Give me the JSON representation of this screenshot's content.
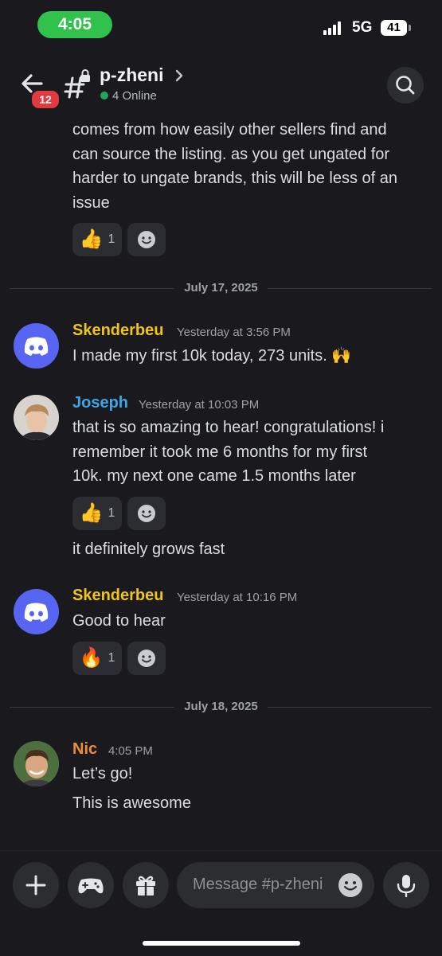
{
  "status_bar": {
    "time": "4:05",
    "network": "5G",
    "battery": "41"
  },
  "header": {
    "unread_badge": "12",
    "channel_name": "p-zheni",
    "online": "4 Online"
  },
  "messages": {
    "m0": {
      "lines": [
        "comes from how easily other sellers find and",
        "can source the listing. as you get ungated for",
        "harder to ungate brands, this will be less of an",
        "issue"
      ],
      "reaction": {
        "emoji": "👍",
        "count": "1"
      }
    },
    "divider1": "July 17, 2025",
    "m1": {
      "author": "Skenderbeu",
      "timestamp": "Yesterday at 3:56 PM",
      "text": "I made my first 10k today, 273 units. 🙌"
    },
    "m2": {
      "author": "Joseph",
      "timestamp": "Yesterday at 10:03 PM",
      "lines": [
        "that is so amazing to hear! congratulations! i",
        "remember it took me 6 months for my first",
        "10k. my next one came 1.5 months later"
      ],
      "reaction": {
        "emoji": "👍",
        "count": "1"
      },
      "followup": "it definitely grows fast"
    },
    "m3": {
      "author": "Skenderbeu",
      "timestamp": "Yesterday at 10:16 PM",
      "text": "Good to hear",
      "reaction": {
        "emoji": "🔥",
        "count": "1"
      }
    },
    "divider2": "July 18, 2025",
    "m4": {
      "author": "Nic",
      "timestamp": "4:05 PM",
      "text": "Let’s go!",
      "followup": "This is awesome"
    }
  },
  "composer": {
    "placeholder": "Message #p-zheni"
  },
  "colors": {
    "skenderbeu": "#f0c419",
    "joseph": "#3ea6e8",
    "nic": "#f08c35",
    "discord_blurple": "#5865f2",
    "online": "#23a55a",
    "badge": "#e03b3f"
  },
  "icons": [
    "back-arrow-icon",
    "channel-hash-lock-icon",
    "chevron-right-icon",
    "search-icon",
    "plus-icon",
    "gamepad-icon",
    "gift-icon",
    "emoji-icon",
    "microphone-icon",
    "add-reaction-icon"
  ]
}
